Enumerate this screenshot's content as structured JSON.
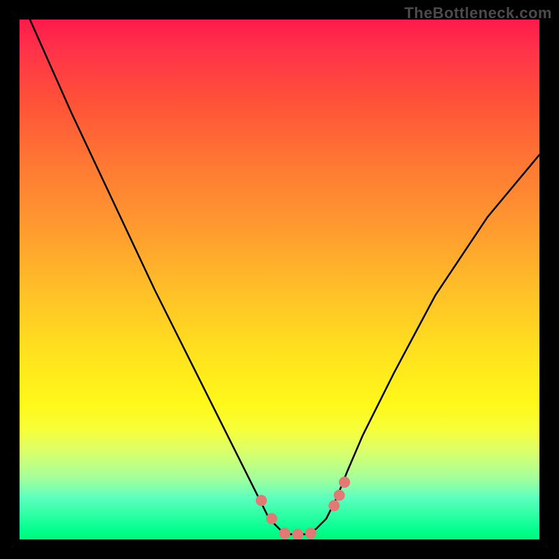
{
  "watermark": "TheBottleneck.com",
  "chart_data": {
    "type": "line",
    "title": "",
    "xlabel": "",
    "ylabel": "",
    "xlim": [
      0,
      100
    ],
    "ylim": [
      0,
      100
    ],
    "grid": false,
    "series": [
      {
        "name": "bottleneck-curve",
        "x": [
          2,
          10,
          18,
          26,
          32,
          38,
          42,
          46,
          48,
          50,
          51,
          53,
          55,
          57,
          59,
          61,
          63,
          66,
          72,
          80,
          90,
          100
        ],
        "values": [
          100,
          82,
          65,
          48,
          36,
          24,
          16,
          8,
          4,
          2,
          1,
          1,
          1,
          2,
          4,
          8,
          13,
          20,
          32,
          47,
          62,
          74
        ]
      }
    ],
    "markers": [
      {
        "name": "marker-left-1",
        "x": 46.5,
        "y": 7.5
      },
      {
        "name": "marker-left-2",
        "x": 48.5,
        "y": 4.0
      },
      {
        "name": "marker-bottom-1",
        "x": 51.0,
        "y": 1.2
      },
      {
        "name": "marker-bottom-2",
        "x": 53.5,
        "y": 1.0
      },
      {
        "name": "marker-bottom-3",
        "x": 56.0,
        "y": 1.2
      },
      {
        "name": "marker-right-1",
        "x": 60.5,
        "y": 6.5
      },
      {
        "name": "marker-right-2",
        "x": 61.5,
        "y": 8.5
      },
      {
        "name": "marker-right-3",
        "x": 62.5,
        "y": 11.0
      }
    ],
    "marker_color": "#e37975",
    "curve_color": "#000000"
  }
}
